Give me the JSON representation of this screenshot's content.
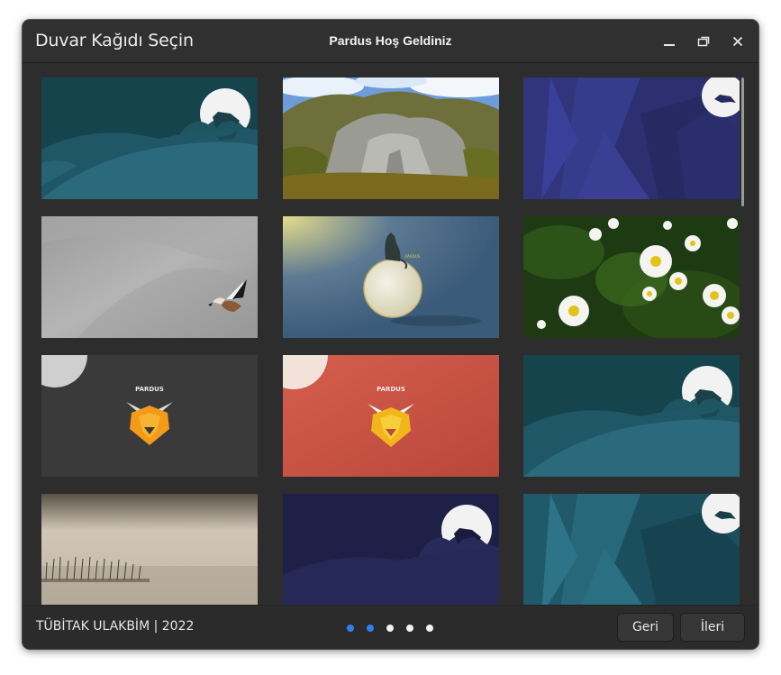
{
  "window": {
    "title": "Duvar Kağıdı Seçin",
    "app_title": "Pardus Hoş Geldiniz"
  },
  "wallpapers": [
    {
      "name": "pardus-leopard-teal"
    },
    {
      "name": "rocky-cliff"
    },
    {
      "name": "leopard-indigo-poly"
    },
    {
      "name": "flying-duck"
    },
    {
      "name": "cat-on-moon"
    },
    {
      "name": "daisies"
    },
    {
      "name": "pardus-lion-dark"
    },
    {
      "name": "pardus-lion-red"
    },
    {
      "name": "pardus-leopard-teal-2"
    },
    {
      "name": "foggy-lake"
    },
    {
      "name": "leopard-navy"
    },
    {
      "name": "leopard-teal-poly"
    }
  ],
  "logo_text": "PARDUS",
  "footer": {
    "copyright": "TÜBİTAK ULAKBİM | 2022",
    "pager": {
      "total": 5,
      "active": [
        0,
        1
      ]
    },
    "back_label": "Geri",
    "next_label": "İleri"
  },
  "colors": {
    "accent": "#2f80ed",
    "window_bg": "#2d2d2d"
  }
}
